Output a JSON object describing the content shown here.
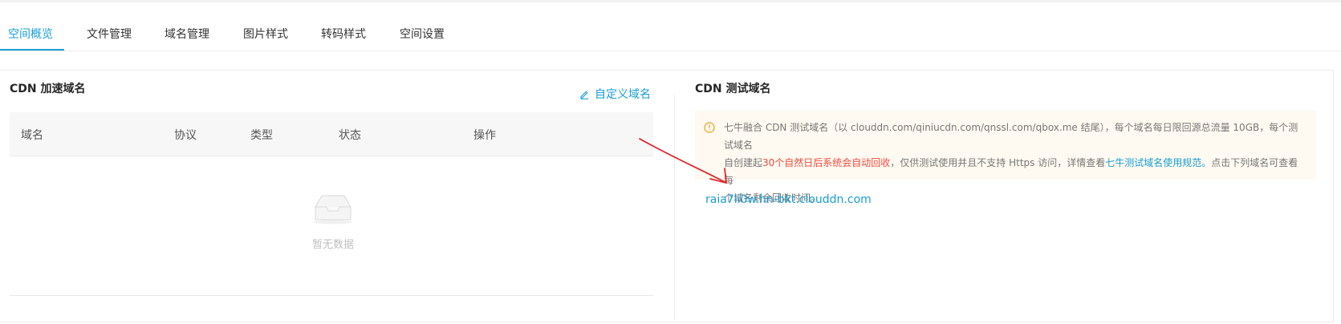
{
  "tabs": [
    {
      "label": "空间概览",
      "active": true
    },
    {
      "label": "文件管理",
      "active": false
    },
    {
      "label": "域名管理",
      "active": false
    },
    {
      "label": "图片样式",
      "active": false
    },
    {
      "label": "转码样式",
      "active": false
    },
    {
      "label": "空间设置",
      "active": false
    }
  ],
  "cdn_section": {
    "title": "CDN 加速域名",
    "custom_link": "自定义域名",
    "columns": [
      "域名",
      "协议",
      "类型",
      "状态",
      "操作"
    ],
    "empty_text": "暂无数据"
  },
  "test_section": {
    "title": "CDN 测试域名",
    "notice": {
      "line1": "七牛融合 CDN 测试域名（以 clouddn.com/qiniucdn.com/qnssl.com/qbox.me 结尾），每个域名每日限回源总流量 10GB，每个测试域名",
      "line2_prefix": "自创建起",
      "line2_highlight": "30个自然日后系统会自动回收",
      "line2_middle": "，仅供测试使用并且不支持 Https 访问，详情查看",
      "line2_link": "七牛测试域名使用规范。",
      "line2_suffix": "点击下列域名可查看每",
      "line3": "个域名剩余回收时间。"
    },
    "domain": "raia7li0w.hn-bkt.clouddn.com"
  },
  "colors": {
    "accent": "#1a9ed3",
    "warning": "#f0a020",
    "highlight_red": "#f0493d",
    "notice_bg": "#fffaf1",
    "annotation_arrow": "#e0262b"
  }
}
